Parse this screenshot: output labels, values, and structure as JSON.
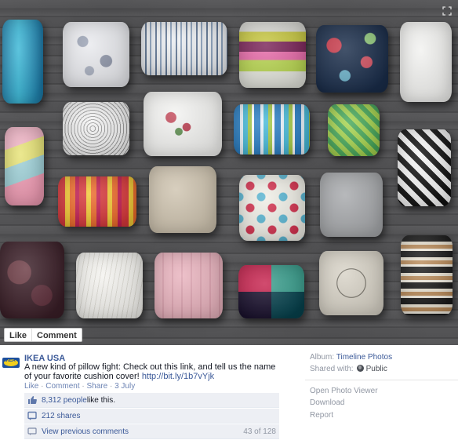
{
  "photo": {
    "action_like": "Like",
    "action_comment": "Comment"
  },
  "post": {
    "page_name": "IKEA USA",
    "caption_text": "A new kind of pillow fight: Check out this link, and tell us the name of your favorite cushion cover!",
    "caption_link": "http://bit.ly/1b7vYjk",
    "meta": {
      "like": "Like",
      "comment": "Comment",
      "share": "Share",
      "separator": " · ",
      "date": "3 July"
    },
    "likes": {
      "count_text": "8,312 people",
      "suffix": " like this."
    },
    "shares": "212 shares",
    "comments": {
      "view_previous": "View previous comments",
      "position": "43 of 128"
    }
  },
  "sidebar": {
    "album_label": "Album: ",
    "album_value": "Timeline Photos",
    "shared_label": "Shared with:",
    "shared_value": "Public",
    "links": [
      "Open Photo Viewer",
      "Download",
      "Report"
    ]
  },
  "colors": {
    "link": "#3b5998",
    "ufi_background": "#edeff4",
    "muted": "#9197a3"
  },
  "icons": [
    "expand-icon",
    "ikea-logo",
    "thumbs-up-icon",
    "share-icon",
    "comment-icon",
    "globe-icon"
  ]
}
